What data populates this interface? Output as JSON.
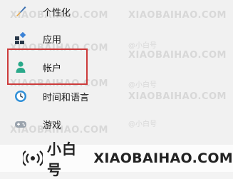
{
  "nav": {
    "items": [
      {
        "label": "个性化",
        "icon": "personalization-brush-icon"
      },
      {
        "label": "应用",
        "icon": "apps-grid-icon"
      },
      {
        "label": "帐户",
        "icon": "account-person-icon"
      },
      {
        "label": "时间和语言",
        "icon": "time-language-globe-icon"
      },
      {
        "label": "游戏",
        "icon": "gaming-controller-icon"
      }
    ],
    "highlighted": "帐户",
    "highlight_color": "#cc3b3b"
  },
  "watermarks": {
    "site_upper": "XIAOBAIHAO.COM",
    "brand_at": "@小白号"
  },
  "brand": {
    "name": "小白号",
    "site": "XIAOBAIHAO.COM"
  },
  "colors": {
    "account_icon": "#2aa98a",
    "brush_handle": "#3a6fb0",
    "brush_tip": "#e6a341",
    "apps_dark": "#2b3a4a",
    "apps_blue": "#3b82d6",
    "globe_blue": "#2f8fd8"
  }
}
